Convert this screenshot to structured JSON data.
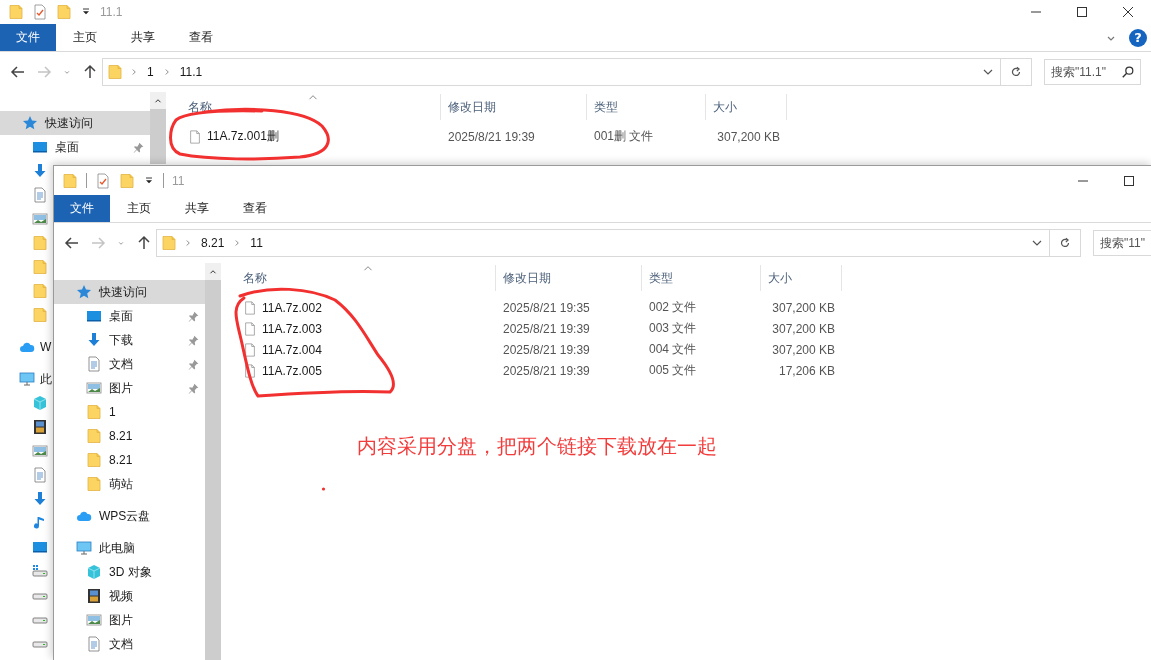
{
  "windows": [
    {
      "kind": "back",
      "title": "11.1",
      "clipped": false,
      "help": "?",
      "ribbon_tabs": [
        {
          "label": "文件",
          "kind": "file"
        },
        {
          "label": "主页",
          "kind": "tab"
        },
        {
          "label": "共享",
          "kind": "tab"
        },
        {
          "label": "查看",
          "kind": "tab"
        }
      ],
      "nav": {
        "back_enabled": true,
        "forward_enabled": false
      },
      "path": [
        "1",
        "11.1"
      ],
      "search": {
        "placeholder": "搜索\"11.1\""
      },
      "sidebar": [
        {
          "label": "快速访问",
          "kind": "star",
          "selected": true,
          "children": [
            {
              "label": "桌面",
              "kind": "desktop",
              "pinned": true,
              "selected": false
            },
            {
              "kind": "download",
              "selected": false
            },
            {
              "kind": "document",
              "selected": false
            },
            {
              "kind": "picture",
              "selected": false
            },
            {
              "kind": "folder",
              "selected": false
            },
            {
              "kind": "folder",
              "selected": false
            },
            {
              "kind": "folder",
              "selected": false
            },
            {
              "kind": "folder",
              "selected": false
            }
          ]
        },
        {
          "label": "W",
          "kind": "cloud",
          "selected": false
        },
        {
          "label": "此",
          "kind": "pc",
          "selected": false,
          "children": [
            {
              "kind": "cube",
              "selected": false
            },
            {
              "kind": "video",
              "selected": false
            },
            {
              "kind": "picture",
              "selected": false
            },
            {
              "kind": "document",
              "selected": false
            },
            {
              "kind": "download",
              "selected": false
            },
            {
              "kind": "music",
              "selected": false
            },
            {
              "kind": "desktop",
              "selected": false
            },
            {
              "kind": "system-drive",
              "selected": false
            },
            {
              "kind": "drive",
              "selected": false
            },
            {
              "kind": "drive",
              "selected": false
            },
            {
              "kind": "drive",
              "selected": false
            }
          ]
        }
      ],
      "columns": [
        "名称",
        "修改日期",
        "类型",
        "大小"
      ],
      "rows": [
        [
          "11A.7z.001删",
          "2025/8/21 19:39",
          "001删 文件",
          "307,200 KB"
        ]
      ]
    },
    {
      "kind": "front",
      "title": "11",
      "clipped": true,
      "ribbon_tabs": [
        {
          "label": "文件",
          "kind": "file"
        },
        {
          "label": "主页",
          "kind": "tab"
        },
        {
          "label": "共享",
          "kind": "tab"
        },
        {
          "label": "查看",
          "kind": "tab"
        }
      ],
      "nav": {
        "back_enabled": true,
        "forward_enabled": false
      },
      "path": [
        "8.21",
        "11"
      ],
      "search": {
        "placeholder": "搜索\"11\""
      },
      "sidebar": [
        {
          "label": "快速访问",
          "kind": "star",
          "selected": true,
          "children": [
            {
              "label": "桌面",
              "kind": "desktop",
              "pinned": true,
              "selected": false
            },
            {
              "label": "下载",
              "kind": "download",
              "pinned": true,
              "selected": false
            },
            {
              "label": "文档",
              "kind": "document",
              "pinned": true,
              "selected": false
            },
            {
              "label": "图片",
              "kind": "picture",
              "pinned": true,
              "selected": false
            },
            {
              "label": "1",
              "kind": "folder",
              "pinned": false,
              "selected": false
            },
            {
              "label": "8.21",
              "kind": "folder",
              "pinned": false,
              "selected": false
            },
            {
              "label": "8.21",
              "kind": "folder",
              "pinned": false,
              "selected": false
            },
            {
              "label": "萌站",
              "kind": "folder",
              "pinned": false,
              "selected": false
            }
          ]
        },
        {
          "label": "WPS云盘",
          "kind": "cloud",
          "selected": false
        },
        {
          "label": "此电脑",
          "kind": "pc",
          "selected": false,
          "children": [
            {
              "label": "3D 对象",
              "kind": "cube",
              "pinned": false,
              "selected": false
            },
            {
              "label": "视频",
              "kind": "video",
              "pinned": false,
              "selected": false
            },
            {
              "label": "图片",
              "kind": "picture",
              "pinned": false,
              "selected": false
            },
            {
              "label": "文档",
              "kind": "document",
              "pinned": false,
              "selected": false
            }
          ]
        }
      ],
      "columns": [
        "名称",
        "修改日期",
        "类型",
        "大小"
      ],
      "rows": [
        [
          "11A.7z.002",
          "2025/8/21 19:35",
          "002 文件",
          "307,200 KB"
        ],
        [
          "11A.7z.003",
          "2025/8/21 19:39",
          "003 文件",
          "307,200 KB"
        ],
        [
          "11A.7z.004",
          "2025/8/21 19:39",
          "004 文件",
          "307,200 KB"
        ],
        [
          "11A.7z.005",
          "2025/8/21 19:39",
          "005 文件",
          "17,206 KB"
        ]
      ]
    }
  ],
  "annotation": {
    "note": "内容采用分盘，把两个链接下载放在一起"
  }
}
